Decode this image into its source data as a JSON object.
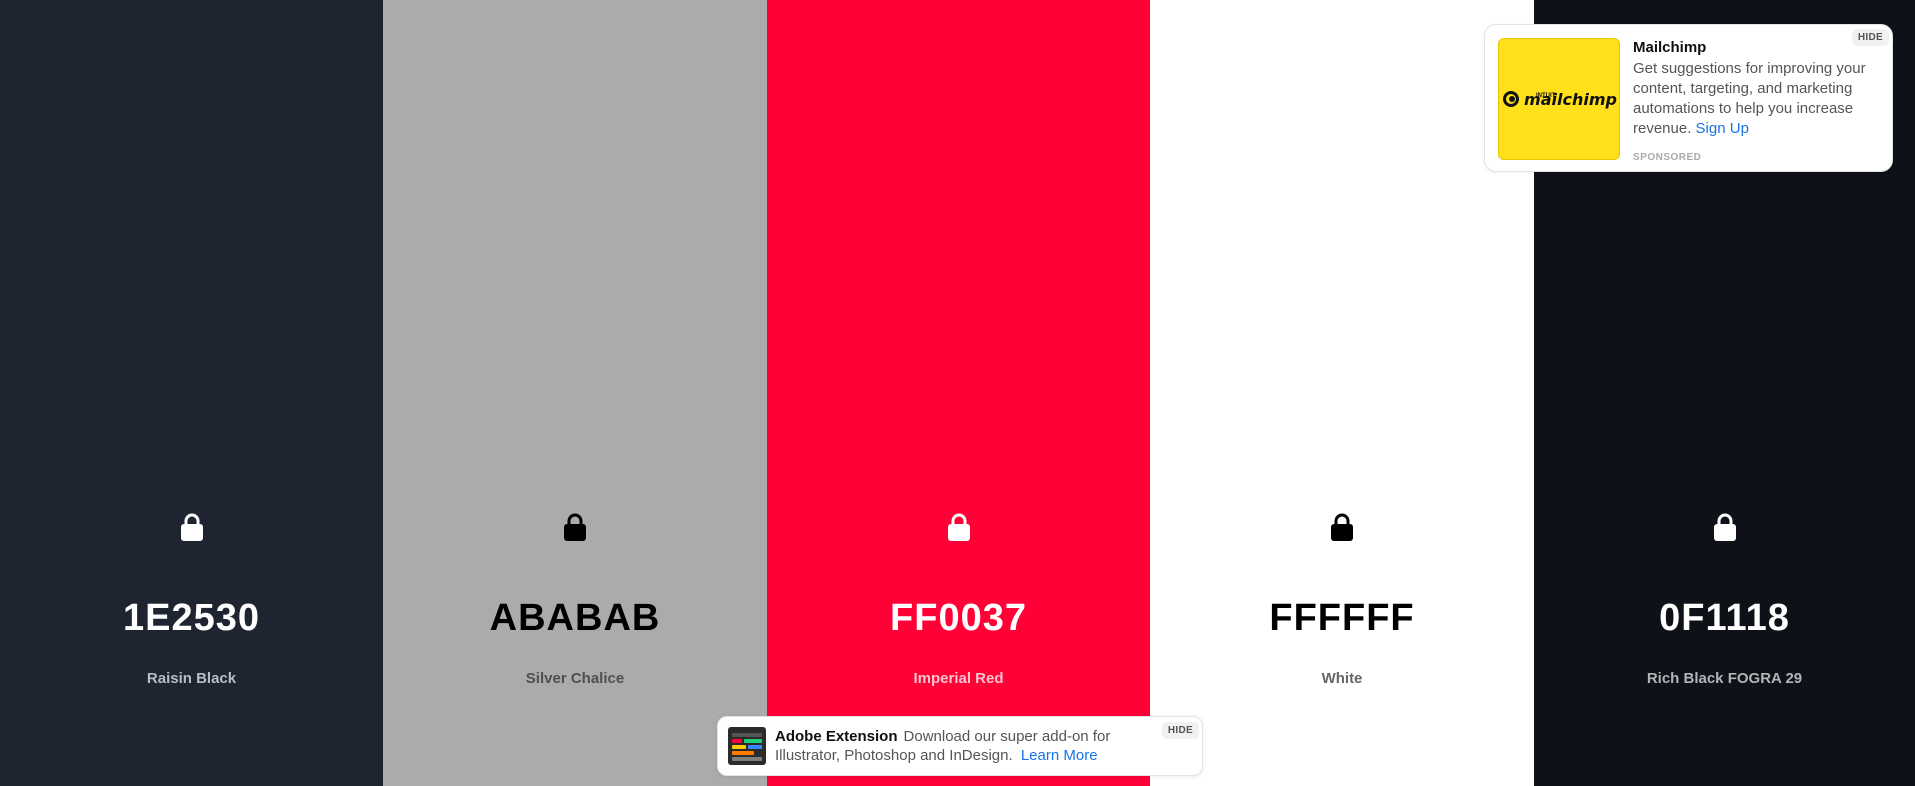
{
  "palette": {
    "colors": [
      {
        "hex": "1E2530",
        "name": "Raisin Black",
        "bg": "#1e2530",
        "fg": "#ffffff",
        "sub": "#b9bcc1",
        "width": 383
      },
      {
        "hex": "ABABAB",
        "name": "Silver Chalice",
        "bg": "#ababab",
        "fg": "#000000",
        "sub": "#4f4f4f",
        "width": 384
      },
      {
        "hex": "FF0037",
        "name": "Imperial Red",
        "bg": "#ff0037",
        "fg": "#ffffff",
        "sub": "#ffc3cf",
        "width": 383
      },
      {
        "hex": "FFFFFF",
        "name": "White",
        "bg": "#ffffff",
        "fg": "#000000",
        "sub": "#666666",
        "width": 384
      },
      {
        "hex": "0F1118",
        "name": "Rich Black FOGRA 29",
        "bg": "#0f1118",
        "fg": "#ffffff",
        "sub": "#b3b4b7",
        "width": 381
      }
    ],
    "lock_icon": "lock-icon"
  },
  "ad_top": {
    "title": "Mailchimp",
    "body": "Get suggestions for improving your content, targeting, and marketing automations to help you increase revenue.",
    "link": "Sign Up",
    "sponsored": "SPONSORED",
    "hide": "HIDE",
    "logo_text": "mailchimp",
    "logo_small": "INTUIT",
    "logo_bg": "#ffe01b"
  },
  "ad_bottom": {
    "title": "Adobe Extension",
    "body": "Download our super add-on for Illustrator, Photoshop and InDesign.",
    "link": "Learn More",
    "hide": "HIDE"
  }
}
